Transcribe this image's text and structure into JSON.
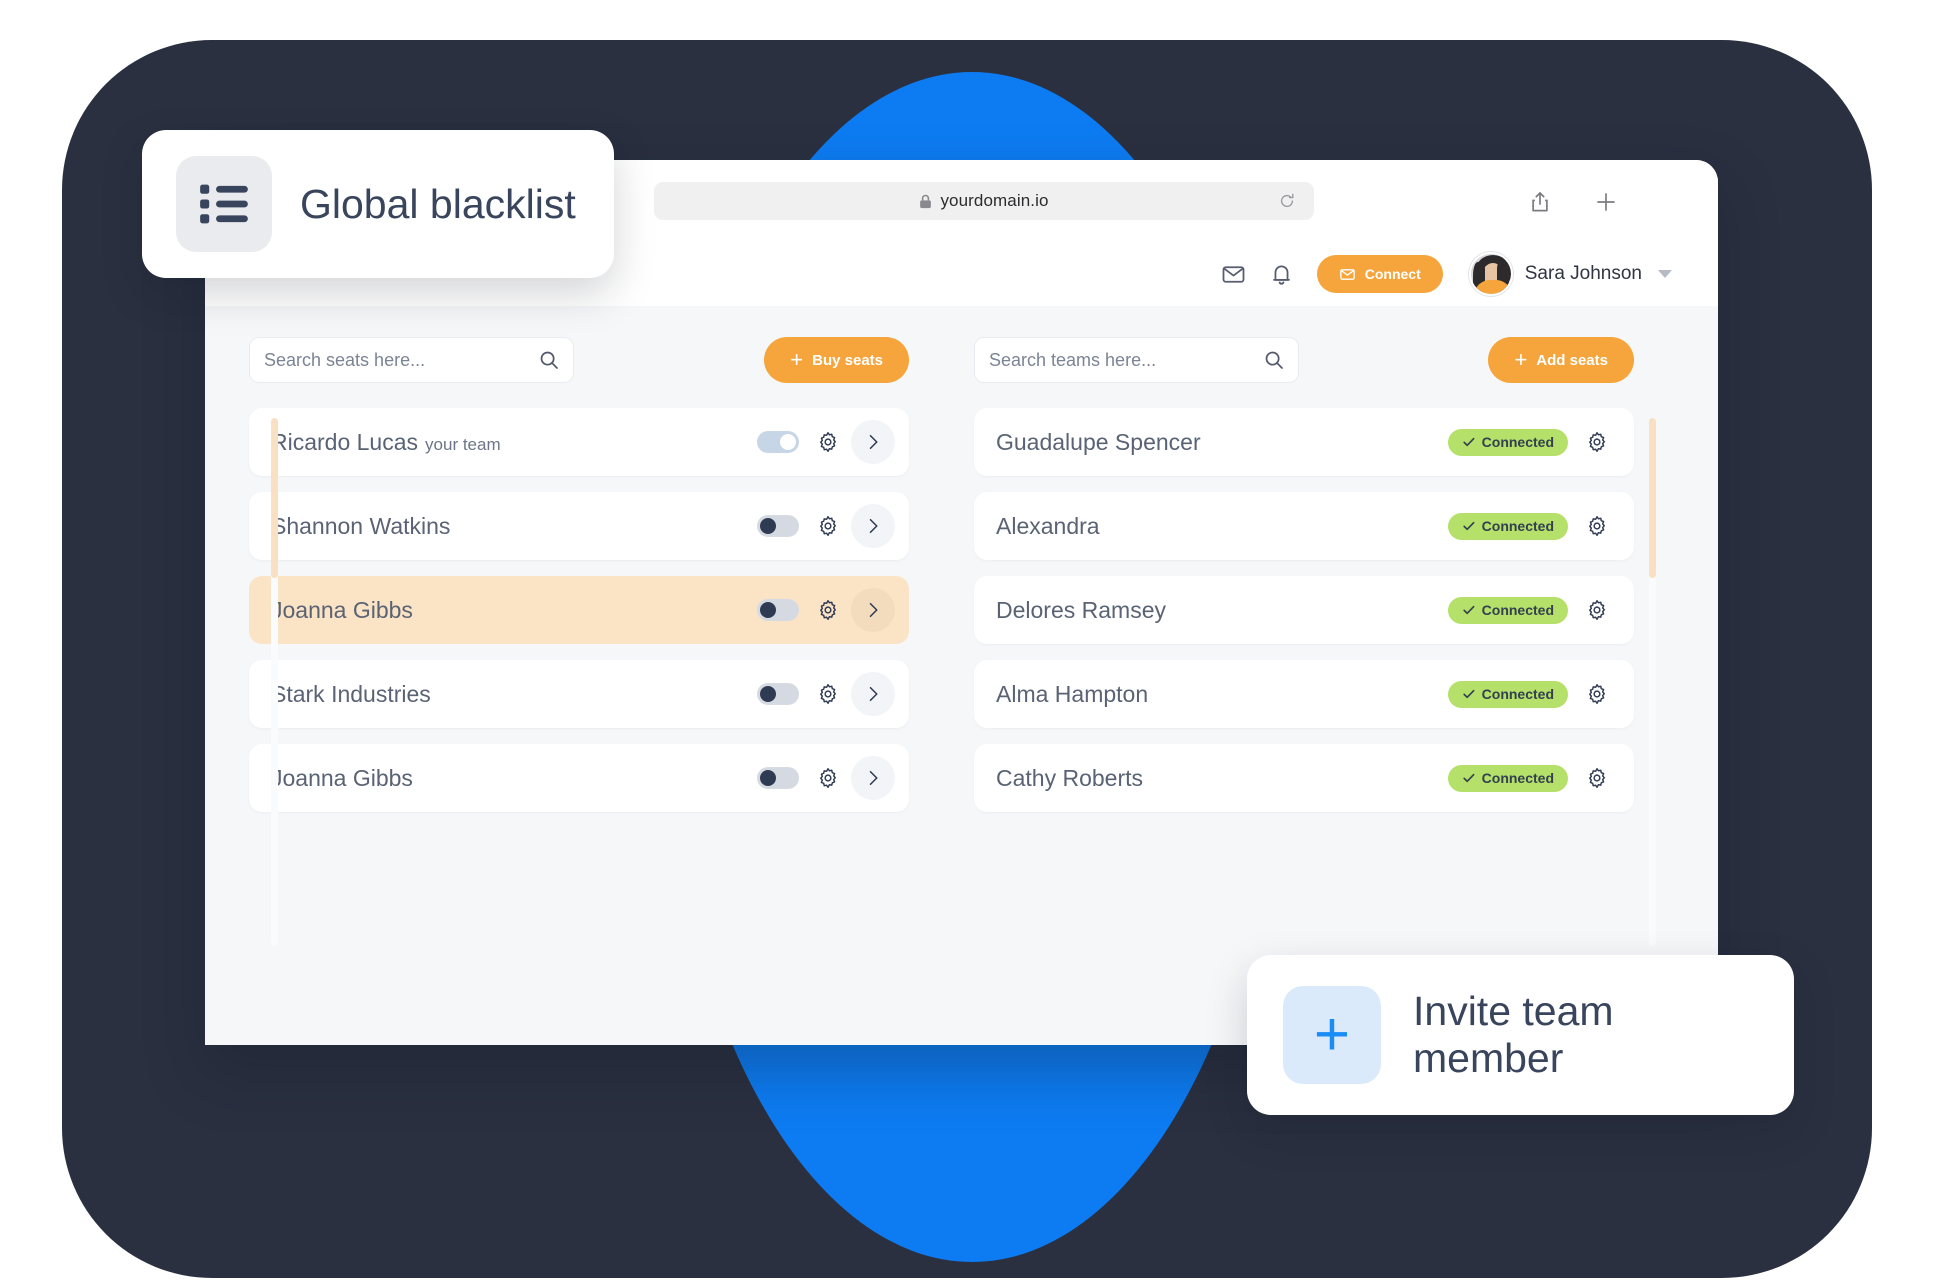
{
  "browser": {
    "url": "yourdomain.io",
    "lock_icon": "lock-icon",
    "reload_icon": "reload-icon",
    "share_icon": "share-icon",
    "newtab_icon": "plus-icon"
  },
  "app_header": {
    "mail_icon": "mail-icon",
    "bell_icon": "bell-icon",
    "connect_label": "Connect",
    "connect_icon": "envelope-icon",
    "user_name": "Sara Johnson",
    "caret_icon": "chevron-down-icon"
  },
  "seats_panel": {
    "search_placeholder": "Search seats here...",
    "search_value": "",
    "search_icon": "search-icon",
    "buy_button_label": "Buy seats",
    "buy_button_icon": "plus-icon",
    "rows": [
      {
        "name": "Ricardo Lucas",
        "sub": "your team",
        "toggle": "on",
        "highlight": false
      },
      {
        "name": "Shannon Watkins",
        "sub": "",
        "toggle": "off",
        "highlight": false
      },
      {
        "name": "Joanna Gibbs",
        "sub": "",
        "toggle": "off",
        "highlight": true
      },
      {
        "name": "Stark Industries",
        "sub": "",
        "toggle": "off",
        "highlight": false
      },
      {
        "name": "Joanna Gibbs",
        "sub": "",
        "toggle": "off",
        "highlight": false
      }
    ]
  },
  "teams_panel": {
    "search_placeholder": "Search teams here...",
    "search_value": "",
    "search_icon": "search-icon",
    "add_button_label": "Add seats",
    "add_button_icon": "plus-icon",
    "status_label": "Connected",
    "rows": [
      {
        "name": "Guadalupe Spencer",
        "status": "Connected"
      },
      {
        "name": "Alexandra",
        "status": "Connected"
      },
      {
        "name": "Delores Ramsey",
        "status": "Connected"
      },
      {
        "name": "Alma Hampton",
        "status": "Connected"
      },
      {
        "name": "Cathy Roberts",
        "status": "Connected"
      }
    ]
  },
  "cards": {
    "blacklist_title": "Global blacklist",
    "blacklist_icon": "list-icon",
    "invite_title": "Invite team member",
    "invite_icon": "plus-icon"
  },
  "colors": {
    "accent_orange": "#f5a53c",
    "accent_blue": "#0d7cf2",
    "status_green": "#b5e06a",
    "backdrop_dark": "#2a3040",
    "highlight_peach": "#fbe3c6"
  }
}
